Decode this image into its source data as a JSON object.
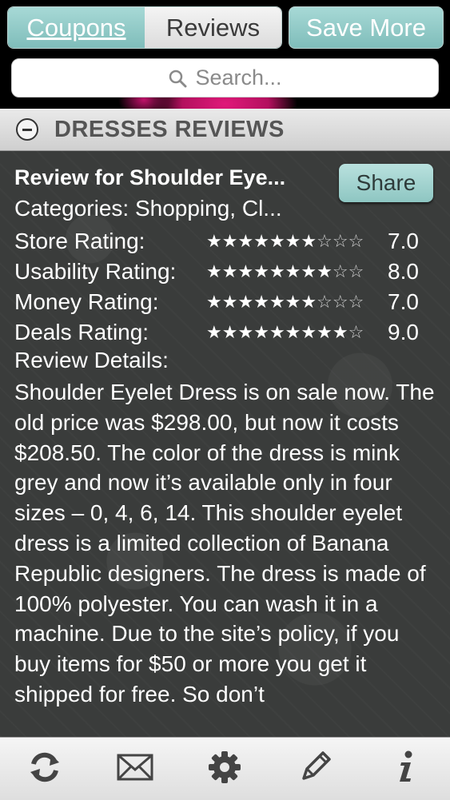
{
  "header": {
    "coupons_tab": "Coupons",
    "reviews_tab": "Reviews",
    "save_more": "Save More",
    "search_placeholder": "Search..."
  },
  "section": {
    "title": "DRESSES REVIEWS"
  },
  "review": {
    "title": "Review for Shoulder Eye...",
    "share_label": "Share",
    "categories": "Categories: Shopping, Cl...",
    "ratings": [
      {
        "label": "Store Rating:",
        "stars": "★★★★★★★☆☆☆",
        "value": "7.0"
      },
      {
        "label": "Usability Rating:",
        "stars": "★★★★★★★★☆☆",
        "value": "8.0"
      },
      {
        "label": "Money Rating:",
        "stars": "★★★★★★★☆☆☆",
        "value": "7.0"
      },
      {
        "label": "Deals Rating:",
        "stars": "★★★★★★★★★☆",
        "value": "9.0"
      }
    ],
    "details_label": "Review Details:",
    "details_text": "Shoulder Eyelet Dress is on sale now. The old price was $298.00, but now it costs $208.50. The color of the dress is mink grey and now it’s available only in four sizes – 0, 4, 6, 14. This shoulder eyelet dress is a limited collection of Banana Republic designers. The dress is made of 100% polyester. You can wash it in a machine. Due to the site’s policy, if you buy items for $50 or more you get it shipped for free. So don’t"
  },
  "toolbar": {
    "icons": [
      "refresh-icon",
      "mail-icon",
      "settings-icon",
      "edit-icon",
      "info-icon"
    ]
  },
  "colors": {
    "accent": "#8fc9c5",
    "content_bg": "#3a3c3b",
    "brand_pink": "#e0197a"
  }
}
